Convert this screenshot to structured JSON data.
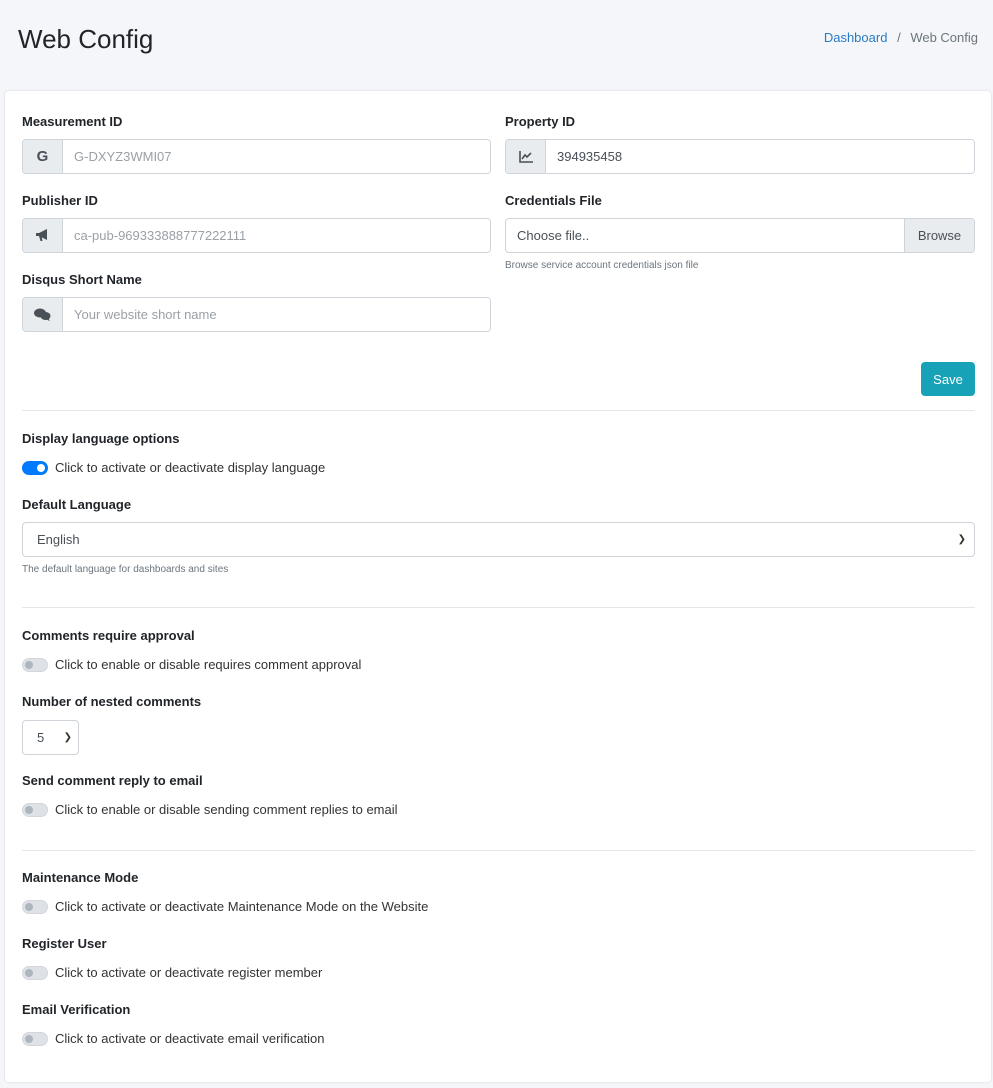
{
  "header": {
    "title": "Web Config",
    "breadcrumb": [
      {
        "label": "Dashboard"
      },
      {
        "label": "Web Config"
      }
    ],
    "separator": "/"
  },
  "form": {
    "measurement": {
      "label": "Measurement ID",
      "placeholder": "G-DXYZ3WMI07",
      "icon": "G"
    },
    "property": {
      "label": "Property ID",
      "value": "394935458"
    },
    "publisher": {
      "label": "Publisher ID",
      "placeholder": "ca-pub-969333888777222111"
    },
    "credentials": {
      "label": "Credentials File",
      "placeholder": "Choose file..",
      "browse": "Browse",
      "help": "Browse service account credentials json file"
    },
    "disqus": {
      "label": "Disqus Short Name",
      "placeholder": "Your website short name"
    },
    "save": "Save"
  },
  "language": {
    "label": "Display language options",
    "toggle": "Click to activate or deactivate display language",
    "toggle_on": true,
    "default_label": "Default Language",
    "default_value": "English",
    "help": "The default language for dashboards and sites"
  },
  "comments": {
    "approval_label": "Comments require approval",
    "approval_toggle": "Click to enable or disable requires comment approval",
    "approval_on": false,
    "nested_label": "Number of nested comments",
    "nested_value": "5",
    "reply_label": "Send comment reply to email",
    "reply_toggle": "Click to enable or disable sending comment replies to email",
    "reply_on": false
  },
  "site": {
    "maintenance_label": "Maintenance Mode",
    "maintenance_toggle": "Click to activate or deactivate Maintenance Mode on the Website",
    "maintenance_on": false,
    "register_label": "Register User",
    "register_toggle": "Click to activate or deactivate register member",
    "register_on": false,
    "verify_label": "Email Verification",
    "verify_toggle": "Click to activate or deactivate email verification",
    "verify_on": false
  },
  "colors": {
    "primary": "#007bff",
    "save": "#17a2b8",
    "link": "#2a7bc4"
  }
}
